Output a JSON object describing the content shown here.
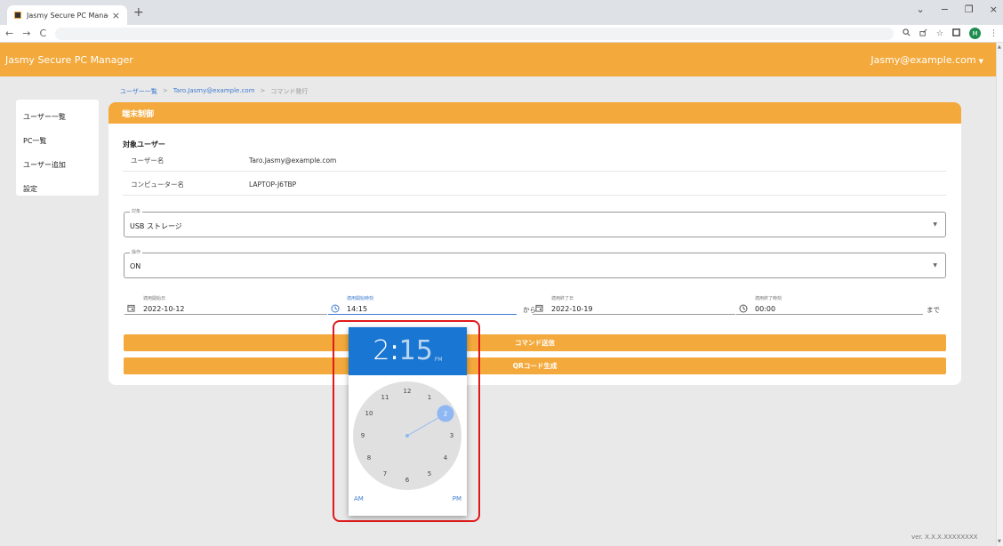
{
  "browser": {
    "tab_title": "Jasmy Secure PC Manager",
    "tab_close": "×",
    "new_tab": "+",
    "win_dropdown": "⌄",
    "win_minimize": "−",
    "win_restore": "❐",
    "win_close": "×",
    "back": "←",
    "forward": "→",
    "reload": "C",
    "profile_initial": "M"
  },
  "header": {
    "app_title": "Jasmy Secure PC Manager",
    "user_email": "Jasmy@example.com"
  },
  "sidebar": {
    "items": [
      {
        "label": "ユーザー一覧"
      },
      {
        "label": "PC一覧"
      },
      {
        "label": "ユーザー追加"
      },
      {
        "label": "設定"
      }
    ]
  },
  "breadcrumb": {
    "items": [
      "ユーザー一覧",
      "Taro.Jasmy@example.com",
      "コマンド発行"
    ],
    "separator": ">"
  },
  "card": {
    "title": "端末制御",
    "section_title": "対象ユーザー",
    "rows": [
      {
        "label": "ユーザー名",
        "value": "Taro.Jasmy@example.com"
      },
      {
        "label": "コンピューター名",
        "value": "LAPTOP-J6TBP"
      }
    ],
    "target": {
      "legend": "対象",
      "value": "USB ストレージ"
    },
    "operation": {
      "legend": "操作",
      "value": "ON"
    },
    "start_date": {
      "label": "適用開始日",
      "value": "2022-10-12"
    },
    "start_time": {
      "label": "適用開始時刻",
      "value": "14:15"
    },
    "end_date": {
      "label": "適用終了日",
      "value": "2022-10-19"
    },
    "end_time": {
      "label": "適用終了時刻",
      "value": "00:00"
    },
    "kara": "から",
    "made": "まで",
    "send_button": "コマンド送信",
    "qr_button": "QRコード生成"
  },
  "clock_picker": {
    "hour": "2",
    "colon": ":",
    "minute": "15",
    "ampm": "PM",
    "am_label": "AM",
    "pm_label": "PM",
    "selected_hour": "2",
    "numbers": [
      "12",
      "1",
      "3",
      "4",
      "5",
      "6",
      "7",
      "8",
      "9",
      "10",
      "11"
    ]
  },
  "version": "ver. X.X.X.XXXXXXXX",
  "colors": {
    "accent": "#f3a93b",
    "picker_blue": "#1976d2",
    "highlight_red": "#e01a1a",
    "link_blue": "#3e7bd0"
  }
}
